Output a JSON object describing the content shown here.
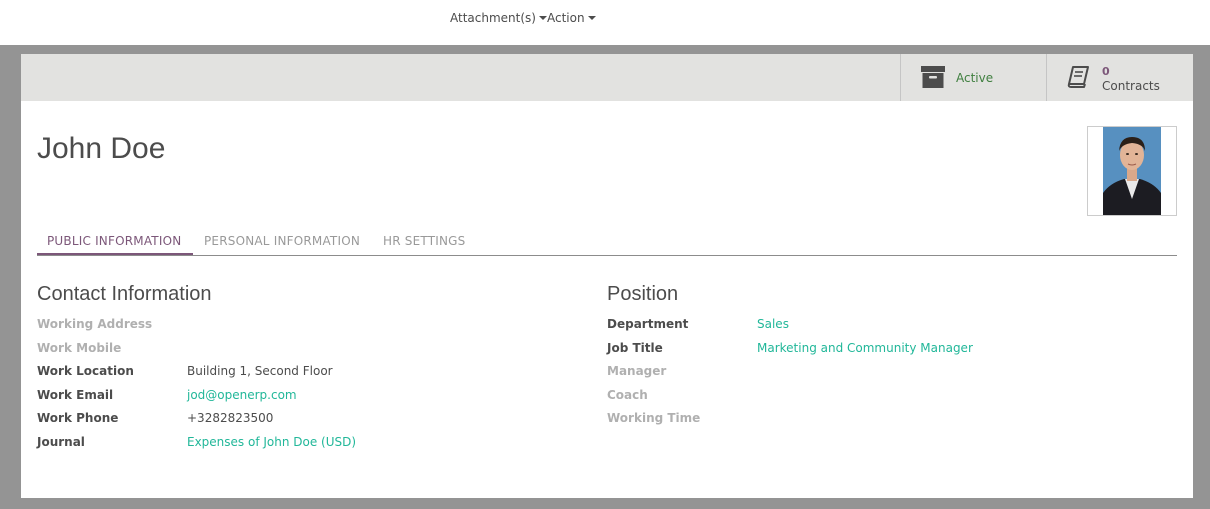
{
  "topbar": {
    "attachments_label": "Attachment(s)",
    "action_label": "Action"
  },
  "buttonbox": {
    "active": {
      "label": "Active",
      "icon": "archive-icon"
    },
    "contracts": {
      "count": "0",
      "label": "Contracts",
      "icon": "book-icon"
    }
  },
  "employee": {
    "name": "John Doe",
    "photo": "employee-photo"
  },
  "tabs": [
    {
      "label": "PUBLIC INFORMATION",
      "active": true
    },
    {
      "label": "PERSONAL INFORMATION",
      "active": false
    },
    {
      "label": "HR SETTINGS",
      "active": false
    }
  ],
  "contact": {
    "title": "Contact Information",
    "fields": [
      {
        "label": "Working Address",
        "value": ""
      },
      {
        "label": "Work Mobile",
        "value": ""
      },
      {
        "label": "Work Location",
        "value": "Building 1, Second Floor"
      },
      {
        "label": "Work Email",
        "value": "jod@openerp.com"
      },
      {
        "label": "Work Phone",
        "value": "+3282823500"
      },
      {
        "label": "Journal",
        "value": "Expenses of John Doe (USD)"
      }
    ]
  },
  "position": {
    "title": "Position",
    "fields": [
      {
        "label": "Department",
        "value": "Sales"
      },
      {
        "label": "Job Title",
        "value": "Marketing and Community Manager"
      },
      {
        "label": "Manager",
        "value": ""
      },
      {
        "label": "Coach",
        "value": ""
      },
      {
        "label": "Working Time",
        "value": ""
      }
    ]
  },
  "colors": {
    "accent": "#7c5779",
    "link": "#21b799",
    "active_status": "#3f7f3f",
    "muted_label": "#b0b0b0",
    "text": "#4c4c4c"
  }
}
